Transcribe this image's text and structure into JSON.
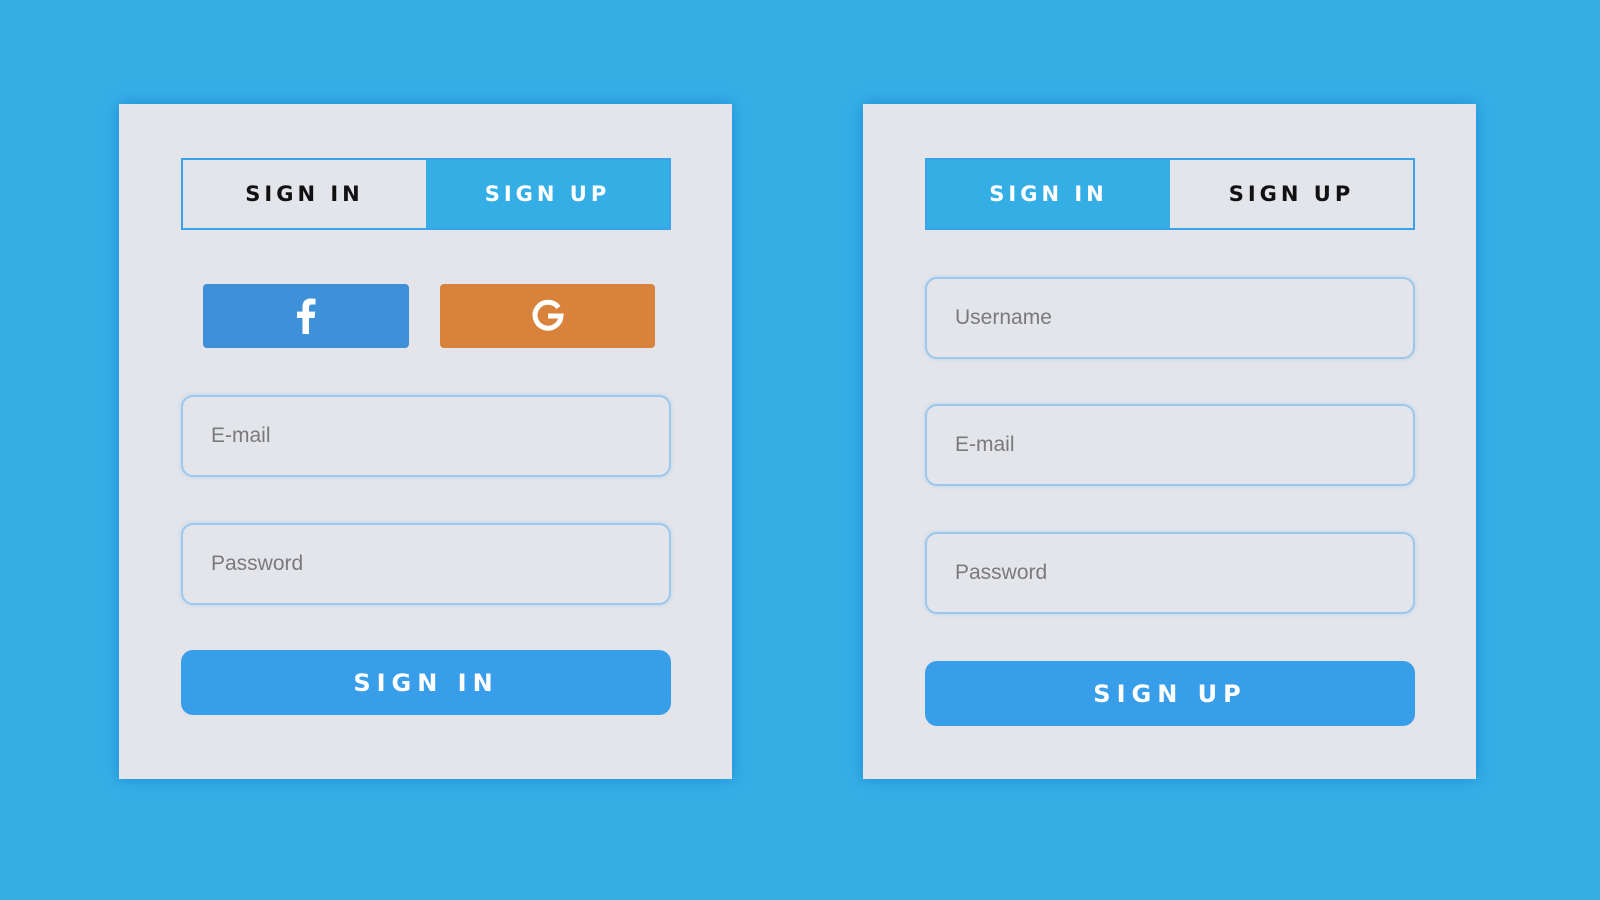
{
  "colors": {
    "background": "#35aee6",
    "card": "#e3e5ea",
    "accent": "#35aee6",
    "button": "#399ee9",
    "facebook": "#3e90d8",
    "google": "#d8823b"
  },
  "signin_card": {
    "tabs": [
      {
        "label": "SIGN IN",
        "active": false
      },
      {
        "label": "SIGN UP",
        "active": true
      }
    ],
    "social": [
      {
        "icon": "facebook-icon"
      },
      {
        "icon": "google-icon"
      }
    ],
    "email": {
      "placeholder": "E-mail",
      "value": ""
    },
    "password": {
      "placeholder": "Password",
      "value": ""
    },
    "submit_label": "SIGN IN"
  },
  "signup_card": {
    "tabs": [
      {
        "label": "SIGN IN",
        "active": true
      },
      {
        "label": "SIGN UP",
        "active": false
      }
    ],
    "username": {
      "placeholder": "Username",
      "value": ""
    },
    "email": {
      "placeholder": "E-mail",
      "value": ""
    },
    "password": {
      "placeholder": "Password",
      "value": ""
    },
    "submit_label": "SIGN UP"
  }
}
